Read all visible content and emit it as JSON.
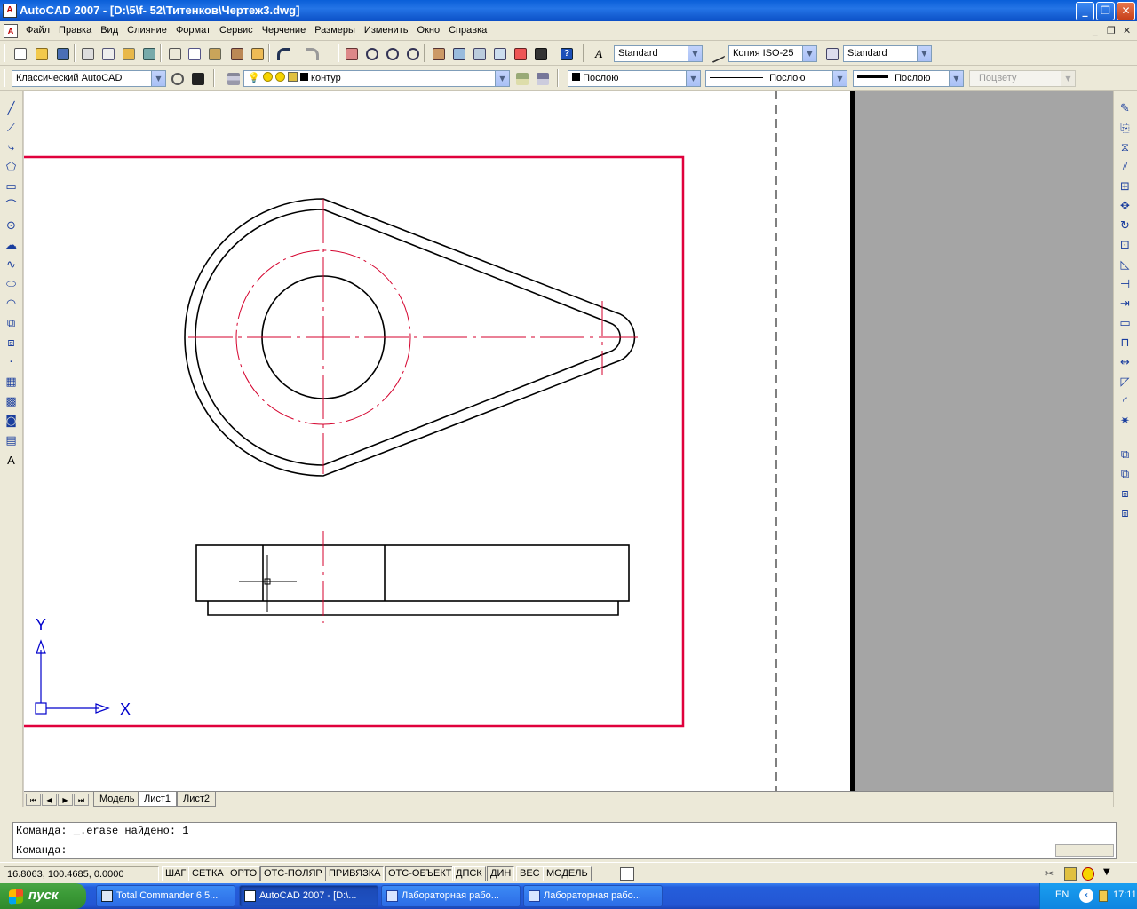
{
  "window": {
    "app_icon": "autocad-logo-icon",
    "title": "AutoCAD 2007 - [D:\\5\\f- 52\\Титенков\\Чертеж3.dwg]",
    "minimize": "_",
    "maximize": "❐",
    "close": "✕"
  },
  "menubar": {
    "doc_icon": "autocad-doc-icon",
    "items": [
      "Файл",
      "Правка",
      "Вид",
      "Слияние",
      "Формат",
      "Сервис",
      "Черчение",
      "Размеры",
      "Изменить",
      "Окно",
      "Справка"
    ],
    "mdi_minimize": "_",
    "mdi_restore": "❐",
    "mdi_close": "✕"
  },
  "styles_toolbar": {
    "text_style": "Standard",
    "dim_style": "Копия ISO-25",
    "table_style": "Standard"
  },
  "workspace_toolbar": {
    "workspace": "Классический AutoCAD",
    "layer": "контур",
    "color": "Послою",
    "linetype": "Послою",
    "lineweight": "Послою",
    "plotstyle": "Поцвету"
  },
  "drawing": {
    "ucs_y": "Y",
    "ucs_x": "X"
  },
  "tabs": {
    "items": [
      "Модель",
      "Лист1",
      "Лист2"
    ],
    "active": "Лист1"
  },
  "command": {
    "history": "Команда: _.erase найдено: 1",
    "prompt": "Команда:"
  },
  "status": {
    "coords": "16.8063, 100.4685, 0.0000",
    "buttons": [
      "ШАГ",
      "СЕТКА",
      "ОРТО",
      "ОТС-ПОЛЯР",
      "ПРИВЯЗКА",
      "ОТС-ОБЪЕКТ",
      "ДПСК",
      "ДИН",
      "ВЕС",
      "МОДЕЛЬ"
    ]
  },
  "taskbar": {
    "start_label": "пуск",
    "tasks": [
      {
        "label": "Total Commander 6.5...",
        "icon": "total-commander-icon",
        "active": false
      },
      {
        "label": "AutoCAD 2007 - [D:\\...",
        "icon": "autocad-icon",
        "active": true
      },
      {
        "label": "Лабораторная рабо...",
        "icon": "word-icon",
        "active": false
      },
      {
        "label": "Лабораторная рабо...",
        "icon": "word-icon",
        "active": false
      }
    ],
    "lang": "EN",
    "clock": "17:11"
  },
  "colors": {
    "frame_red": "#e0003c",
    "centerline_red": "#d4002c",
    "ucs_blue": "#0000cc",
    "titlebar_blue": "#0a5fd8"
  }
}
